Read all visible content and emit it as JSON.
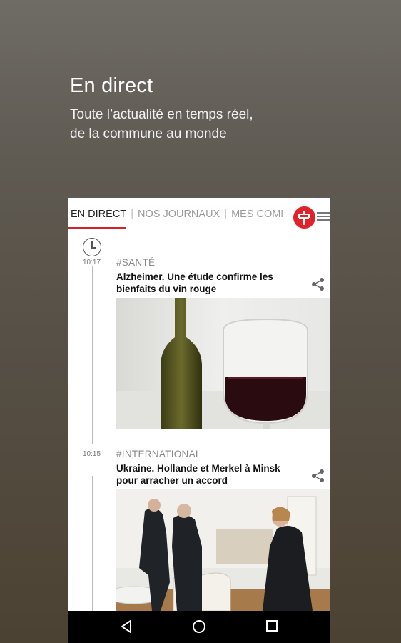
{
  "promo": {
    "title": "En direct",
    "subtitle_line1": "Toute l’actualité en temps réel,",
    "subtitle_line2": "de la commune au monde"
  },
  "tabs": [
    {
      "label": "EN DIRECT",
      "active": true
    },
    {
      "label": "NOS JOURNAUX",
      "active": false
    },
    {
      "label": "MES COMMU",
      "active": false
    }
  ],
  "separator": "|",
  "accent_color": "#d62027",
  "articles": [
    {
      "time": "10:17",
      "tag": "#SANTÉ",
      "title": "Alzheimer. Une étude confirme les bienfaits du vin rouge",
      "image": "red-wine-glass-and-bottle-photo"
    },
    {
      "time": "10:15",
      "tag": "#INTERNATIONAL",
      "title": "Ukraine. Hollande et Merkel à Minsk pour arracher un accord",
      "image": "leaders-meeting-photo"
    }
  ],
  "icons": {
    "clock": "clock-icon",
    "share": "share-icon",
    "logo": "brand-logo",
    "menu": "hamburger-menu-icon",
    "back": "back-icon",
    "home": "home-icon",
    "recents": "recents-icon"
  }
}
